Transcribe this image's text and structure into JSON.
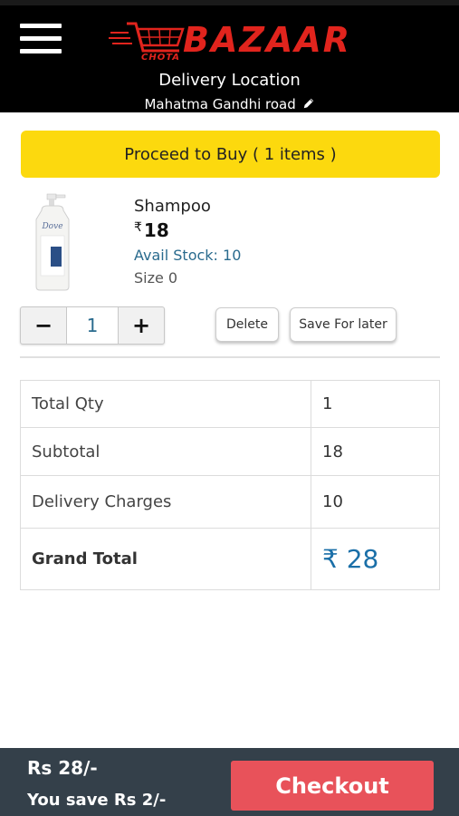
{
  "header": {
    "logo_top": "CHOTA",
    "logo_main": "BAZAAR",
    "delivery_label": "Delivery Location",
    "delivery_address": "Mahatma Gandhi road",
    "brand_color": "#e1241d"
  },
  "proceed_button": {
    "label": "Proceed to Buy ( 1 items )",
    "color": "#fcd90e"
  },
  "cart_item": {
    "name": "Shampoo",
    "currency": "₹",
    "price": "18",
    "avail_stock": "Avail Stock: 10",
    "size": "Size 0",
    "quantity": "1",
    "minus_label": "−",
    "plus_label": "+",
    "delete_label": "Delete",
    "save_later_label": "Save For later"
  },
  "summary": {
    "rows": [
      {
        "label": "Total Qty",
        "value": "1"
      },
      {
        "label": "Subtotal",
        "value": "18"
      },
      {
        "label": "Delivery Charges",
        "value": "10"
      }
    ],
    "grand_total_label": "Grand Total",
    "grand_total_value": "₹ 28"
  },
  "bottom_bar": {
    "total": "Rs 28/-",
    "savings": "You save Rs 2/-",
    "checkout_label": "Checkout",
    "checkout_color": "#e8525a"
  }
}
